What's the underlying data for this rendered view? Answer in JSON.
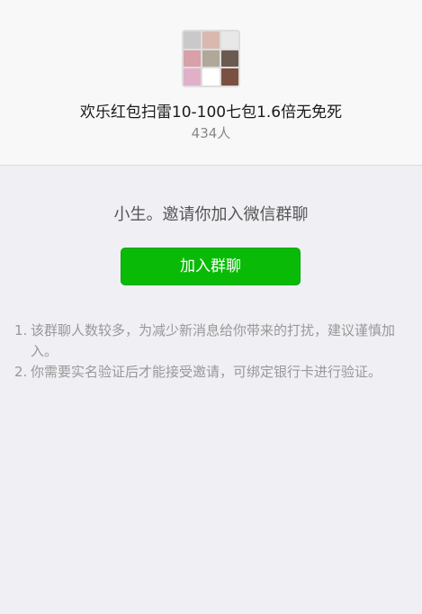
{
  "group": {
    "name": "欢乐红包扫雷10-100七包1.6倍无免死",
    "member_count": "434人",
    "avatar_tiles": [
      "#c9c9c9",
      "#d9b8b0",
      "#e8e8e8",
      "#d8a0a8",
      "#b0a898",
      "#6a5a50",
      "#e0b0c8",
      "#ffffff",
      "#7a5040"
    ]
  },
  "invite": {
    "text": "小生。邀请你加入微信群聊",
    "join_button": "加入群聊"
  },
  "notes": [
    {
      "num": "1.",
      "text": "该群聊人数较多，为减少新消息给你带来的打扰，建议谨慎加入。"
    },
    {
      "num": "2.",
      "text": "你需要实名验证后才能接受邀请，可绑定银行卡进行验证。"
    }
  ],
  "colors": {
    "accent": "#09bb07",
    "background": "#efeff4",
    "header_bg": "#f8f8f8"
  }
}
